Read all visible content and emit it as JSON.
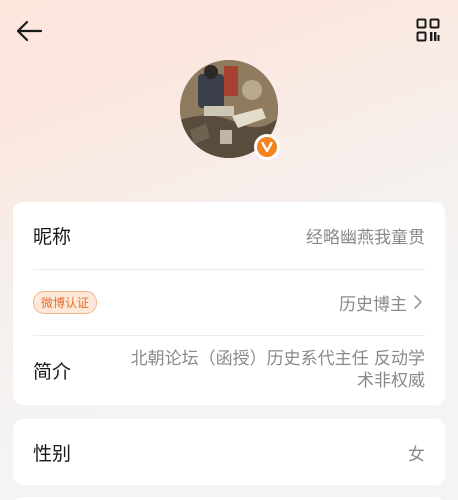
{
  "icons": {
    "back": "arrow-left-icon",
    "qr": "qr-code-icon",
    "badge": "verified-v-icon",
    "chevron": "chevron-right-icon"
  },
  "colors": {
    "accent": "#f5811f",
    "tag_text": "#e5702a",
    "tag_bg": "#fde8da",
    "muted_text": "#8a8a8a"
  },
  "badge": {
    "letter": "V"
  },
  "profile": {
    "nickname_label": "昵称",
    "nickname_value": "经略幽燕我童贯",
    "weibo_tag": "微博认证",
    "verification_value": "历史博主",
    "bio_label": "简介",
    "bio_value": "北朝论坛（函授）历史系代主任 反动学术非权威",
    "gender_label": "性别",
    "gender_value": "女"
  }
}
